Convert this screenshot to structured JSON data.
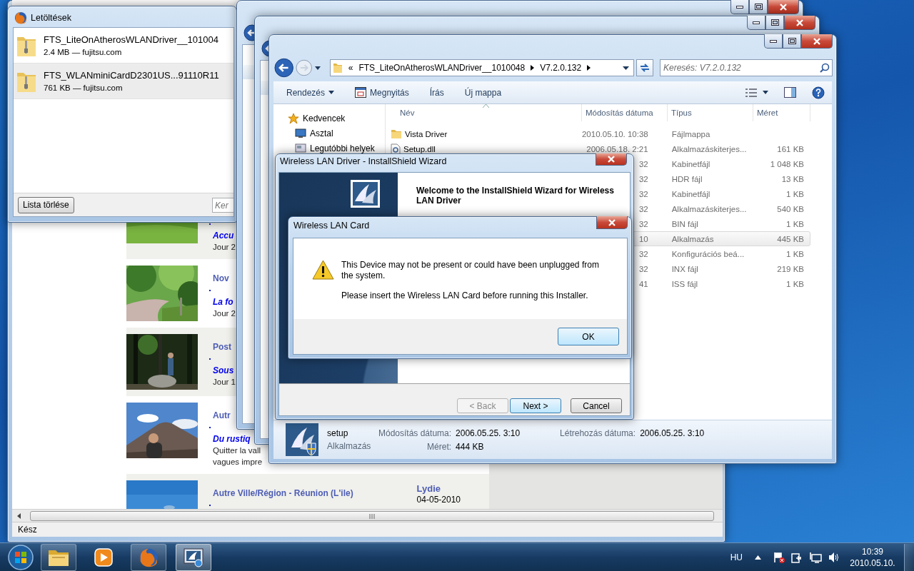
{
  "browser": {
    "posts": [
      {
        "image": {
          "kind": "picture"
        },
        "title": "Accu",
        "lines": [
          "Jour 2"
        ]
      },
      {
        "image": {
          "kind": "picture"
        },
        "category": "Nov",
        "title": "La fo",
        "lines": [
          "Jour 2"
        ]
      },
      {
        "image": {
          "kind": "picture"
        },
        "category": "Post",
        "title": "Sous",
        "lines": [
          "Jour 1"
        ]
      },
      {
        "image": {
          "kind": "picture"
        },
        "category": "Autr",
        "title": "Du rustiq",
        "lines": [
          "Quitter la vall",
          "vagues impre"
        ]
      },
      {
        "image": {
          "kind": "picture"
        },
        "category": "Autre Ville/Région - Réunion (L'ile)",
        "author": "Lydie",
        "date": "04-05-2010"
      }
    ],
    "status": "Kész"
  },
  "downloads": {
    "title": "Letöltések",
    "items": [
      {
        "name": "FTS_LiteOnAtherosWLANDriver__101004",
        "info": "2.4 MB — fujitsu.com",
        "selected": false
      },
      {
        "name": "FTS_WLANminiCardD2301US...91110R11",
        "info": "761 KB — fujitsu.com",
        "selected": true
      }
    ],
    "clear_button": "Lista törlése",
    "search": {
      "placeholder": "Ker"
    }
  },
  "explorer": {
    "path": [
      "«",
      "FTS_LiteOnAtherosWLANDriver__1010048",
      "V7.2.0.132"
    ],
    "search": {
      "placeholder": "Keresés: V7.2.0.132"
    },
    "toolbar": [
      {
        "label": "Rendezés",
        "kind": "menu"
      },
      {
        "label": "Megnyitás",
        "kind": "icon"
      },
      {
        "label": "Írás",
        "kind": "plain"
      },
      {
        "label": "Új mappa",
        "kind": "plain"
      }
    ],
    "nav": [
      {
        "label": "Kedvencek",
        "kind": "star"
      },
      {
        "label": "Asztal",
        "kind": "desktop"
      },
      {
        "label": "Legutóbbi helyek",
        "kind": "recent"
      }
    ],
    "columns": [
      "Név",
      "Módosítás dátuma",
      "Típus",
      "Méret"
    ],
    "files": [
      {
        "kind": "folder",
        "name": "Vista Driver",
        "date": "2010.05.10. 10:38",
        "type": "Fájlmappa",
        "selected": false
      },
      {
        "kind": "dll",
        "name": "Setup.dll",
        "date": "2006.05.18. 2:21",
        "type": "Alkalmazáskiterjes...",
        "size": "161 KB",
        "selected": false
      },
      {
        "date": "32",
        "type": "Kabinetfájl",
        "size": "1 048 KB",
        "selected": false
      },
      {
        "date": "32",
        "type": "HDR fájl",
        "size": "13 KB",
        "selected": false
      },
      {
        "date": "32",
        "type": "Kabinetfájl",
        "size": "1 KB",
        "selected": false
      },
      {
        "date": "32",
        "type": "Alkalmazáskiterjes...",
        "size": "540 KB",
        "selected": false
      },
      {
        "date": "32",
        "type": "BIN fájl",
        "size": "1 KB",
        "selected": false
      },
      {
        "date": "10",
        "type": "Alkalmazás",
        "size": "445 KB",
        "selected": true
      },
      {
        "date": "32",
        "type": "Konfigurációs beá...",
        "size": "1 KB",
        "selected": false
      },
      {
        "date": "32",
        "type": "INX fájl",
        "size": "219 KB",
        "selected": false
      },
      {
        "date": "41",
        "type": "ISS fájl",
        "size": "1 KB",
        "selected": false
      }
    ],
    "details": {
      "name": "setup",
      "type": "Alkalmazás",
      "fields": [
        {
          "label": "Módosítás dátuma:",
          "value": "2006.05.25. 3:10"
        },
        {
          "label": "Létrehozás dátuma:",
          "value": "2006.05.25. 3:10"
        },
        {
          "label": "Méret:",
          "value": "444 KB"
        }
      ]
    }
  },
  "wizard": {
    "title": "Wireless LAN Driver - InstallShield Wizard",
    "heading": "Welcome to the InstallShield Wizard for Wireless LAN Driver",
    "buttons": [
      {
        "label": "< Back",
        "disabled": true,
        "default": false
      },
      {
        "label": "Next >",
        "disabled": false,
        "default": true
      },
      {
        "label": "Cancel",
        "disabled": false,
        "default": false
      }
    ]
  },
  "message_box": {
    "title": "Wireless LAN Card",
    "messages": [
      "This Device may not be present or could have been unplugged from the system.",
      "Please insert the Wireless LAN Card before running this Installer."
    ],
    "button": "OK"
  },
  "taskbar": {
    "apps": [
      {
        "running": true,
        "active": false
      },
      {
        "running": false,
        "active": false
      },
      {
        "running": true,
        "active": false
      },
      {
        "running": true,
        "active": true
      }
    ],
    "language": "HU",
    "time": "10:39",
    "date": "2010.05.10."
  }
}
